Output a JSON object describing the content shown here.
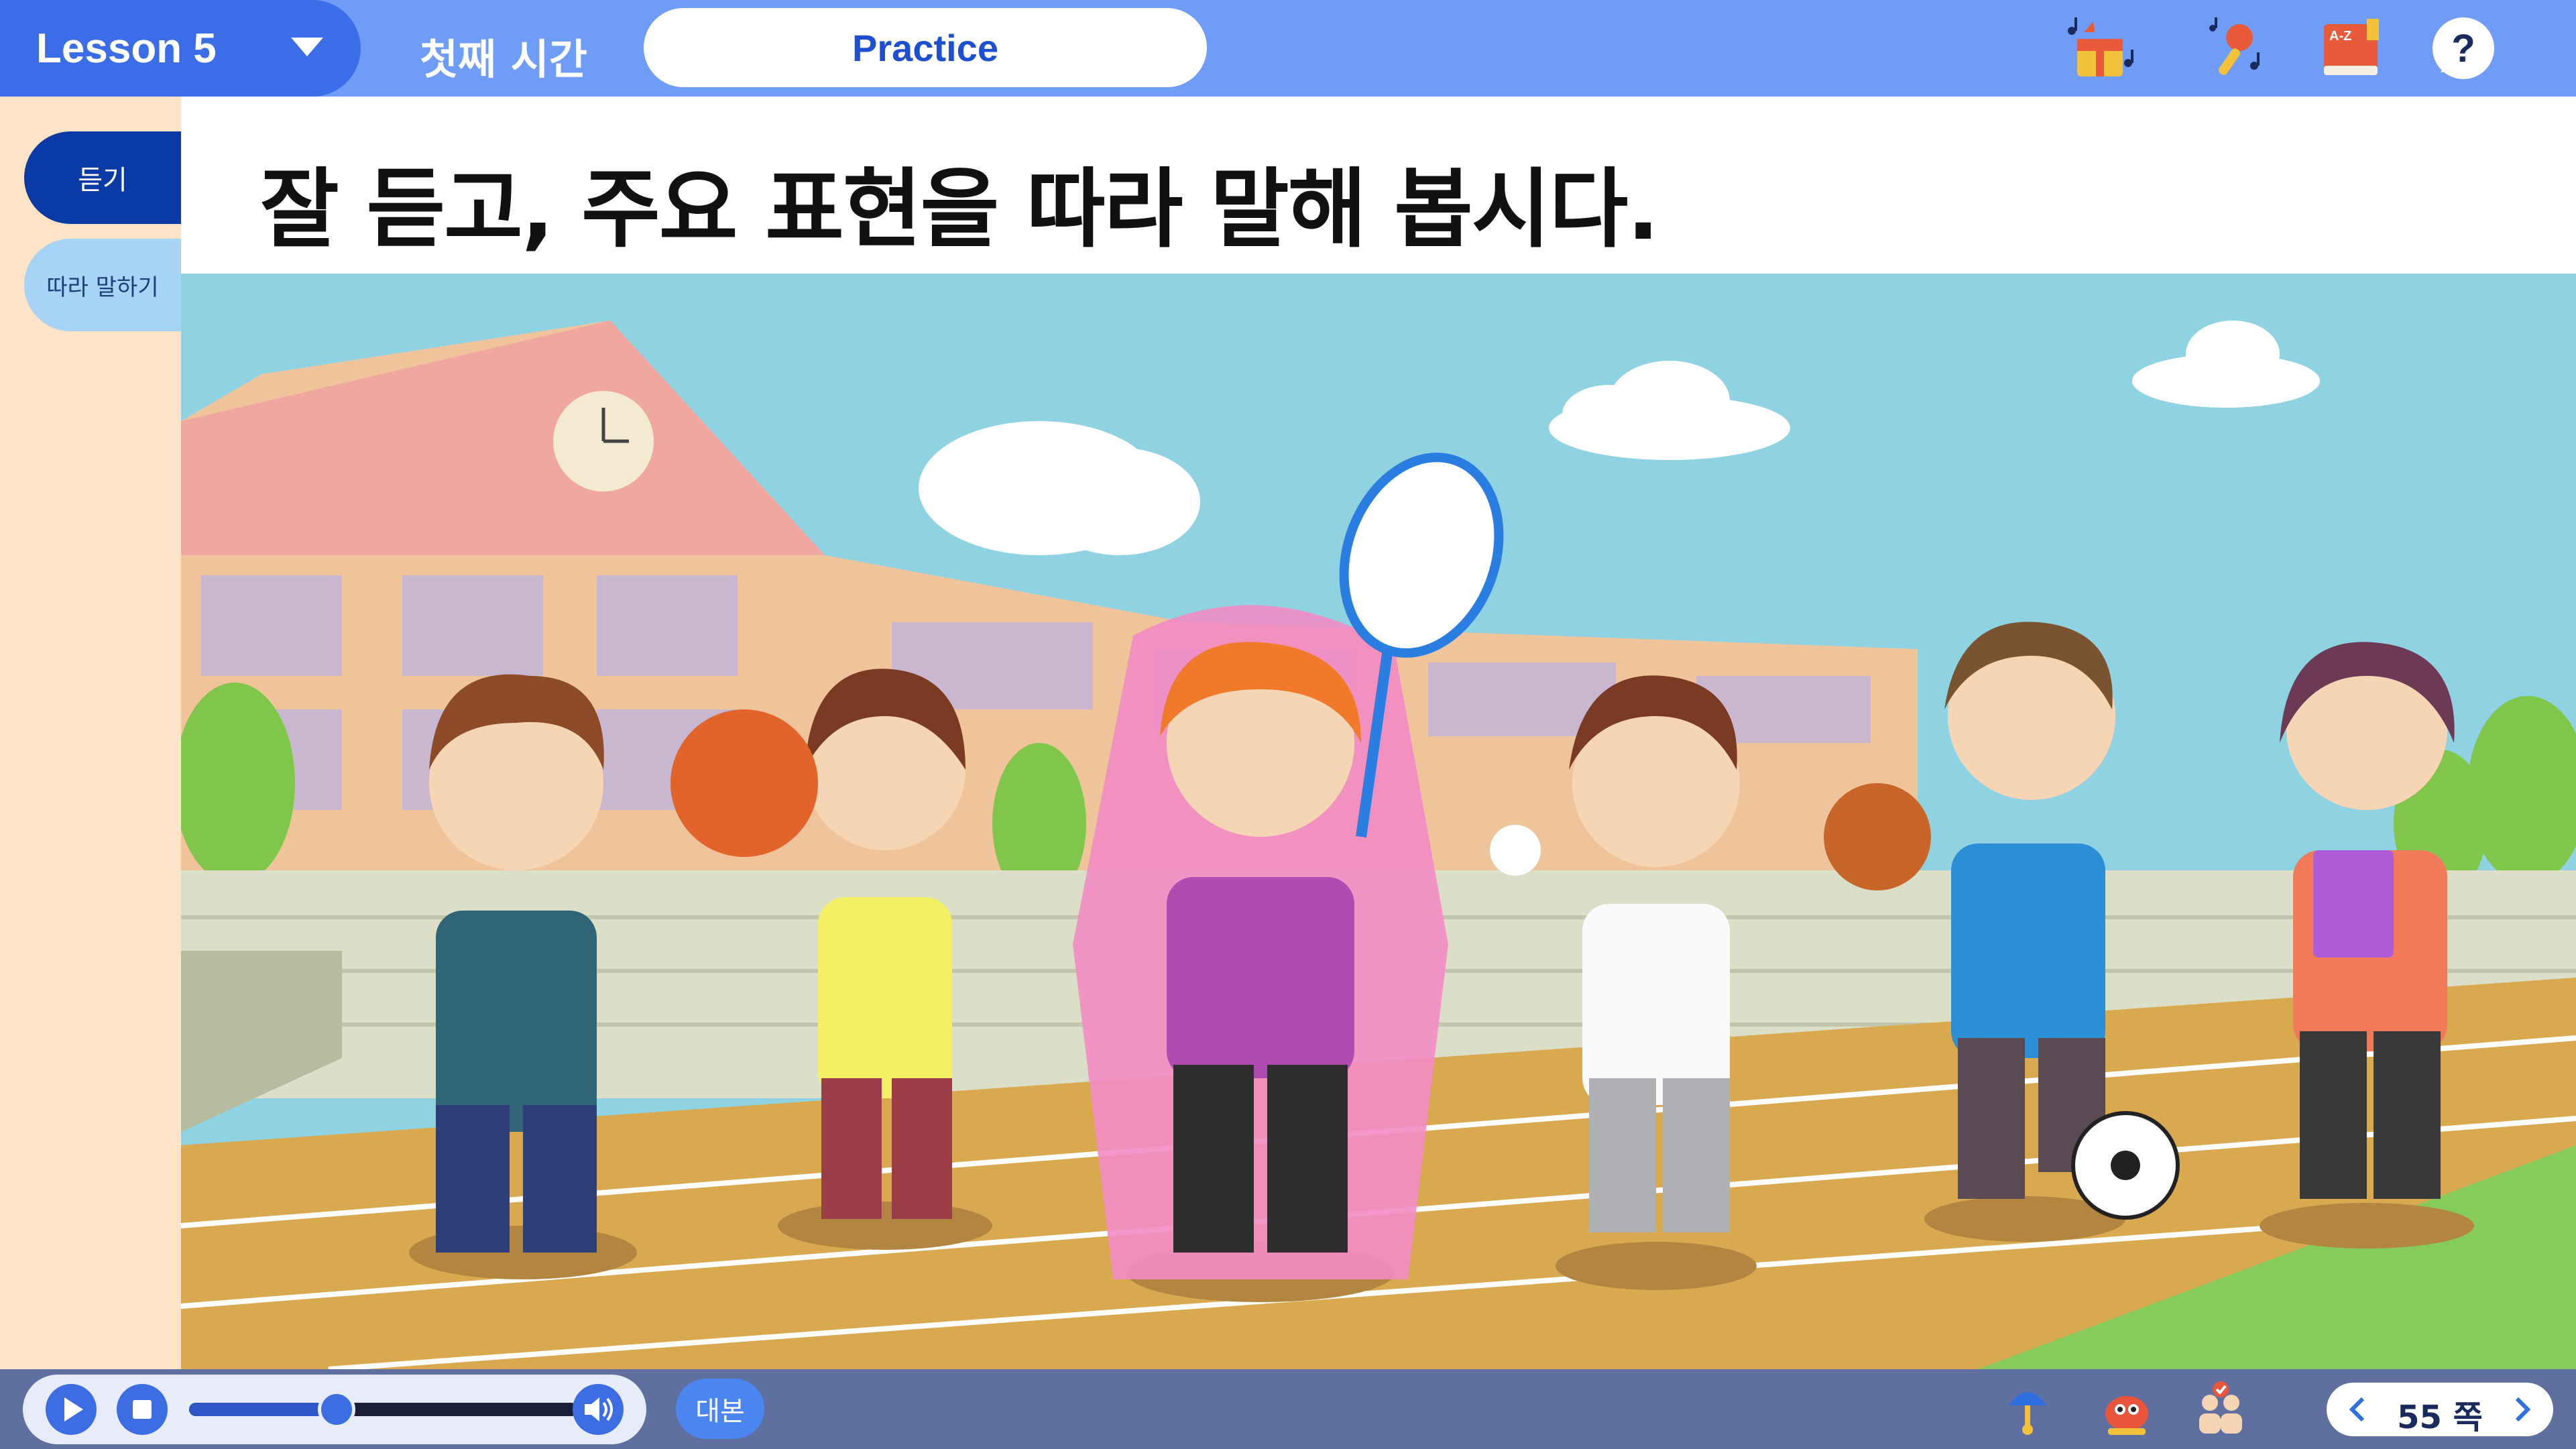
{
  "header": {
    "lesson_label": "Lesson 5",
    "period_label": "첫째 시간",
    "tab_label": "Practice",
    "tools": [
      "music-box-icon",
      "singing-icon",
      "dictionary-icon",
      "help-icon"
    ]
  },
  "sidenav": {
    "items": [
      {
        "label": "듣기",
        "active": true
      },
      {
        "label": "따라 말하기",
        "active": false
      }
    ]
  },
  "instruction": "잘 듣고, 주요 표현을 따라 말해 봅시다.",
  "player": {
    "progress": 0.38,
    "script_label": "대본"
  },
  "bottom_tools": [
    "pointer-tool-icon",
    "bug-character-icon",
    "group-activity-icon"
  ],
  "pager": {
    "page_label": "55 쪽"
  },
  "colors": {
    "top_bar": "#6f9cf6",
    "lesson_button": "#3b6de8",
    "active_nav": "#0a3aa6",
    "inactive_nav": "#a7d3f4",
    "bottom_bar": "#5e6fa0",
    "accent": "#3c6de3"
  }
}
